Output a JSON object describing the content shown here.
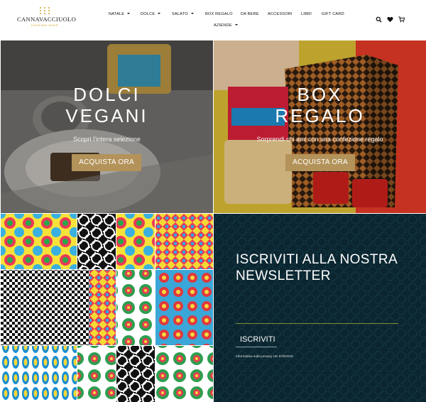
{
  "brand": {
    "name": "CANNAVACCIUOLO",
    "tagline": "COOKING SHOP",
    "gold": "#c9a227"
  },
  "nav": {
    "items": [
      {
        "label": "NATALE",
        "dropdown": true
      },
      {
        "label": "DOLCE",
        "dropdown": true
      },
      {
        "label": "SALATO",
        "dropdown": true
      },
      {
        "label": "BOX REGALO",
        "dropdown": false
      },
      {
        "label": "DA BERE",
        "dropdown": false
      },
      {
        "label": "ACCESSORI",
        "dropdown": false
      },
      {
        "label": "LIBRI",
        "dropdown": false
      },
      {
        "label": "GIFT CARD",
        "dropdown": false
      },
      {
        "label": "AZIENDE",
        "dropdown": true
      }
    ],
    "icons": [
      "search-icon",
      "heart-icon",
      "cart-icon"
    ]
  },
  "hero": {
    "dolci": {
      "title_line1": "DOLCI",
      "title_line2": "VEGANI",
      "subtitle": "Scopri l'intera selezione",
      "button": "ACQUISTA ORA"
    },
    "box": {
      "title_line1": "BOX",
      "title_line2": "REGALO",
      "subtitle": "Sorprendi chi ami con una confezione regalo",
      "button": "ACQUISTA ORA"
    },
    "button_color": "#b3935a"
  },
  "newsletter": {
    "title": "ISCRIVITI ALLA NOSTRA NEWSLETTER",
    "email_value": "",
    "button": "ISCRIVITI",
    "privacy": "Informativa sulla privacy UE 679/2016",
    "background": "#0b2630"
  }
}
